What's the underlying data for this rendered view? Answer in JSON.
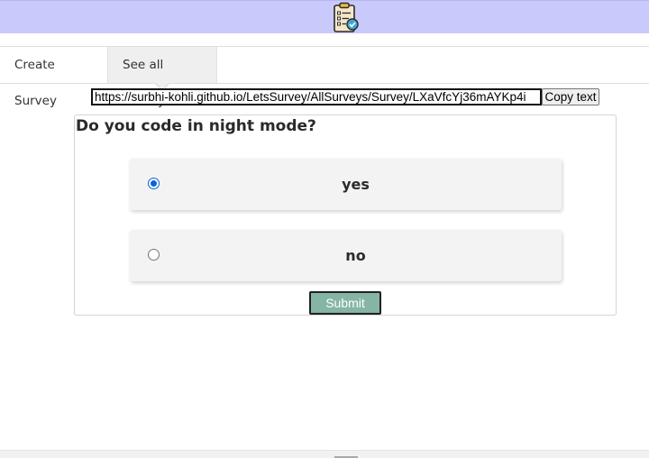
{
  "header": {
    "logo_icon": "clipboard-checklist-icon",
    "brand_color": "#c9c9fb"
  },
  "nav": {
    "tabs": [
      {
        "label": "Create Survey",
        "active": false
      },
      {
        "label": "See all Surveys",
        "active": true
      }
    ]
  },
  "share": {
    "url": "https://surbhi-kohli.github.io/LetsSurvey/AllSurveys/Survey/LXaVfcYj36mAYKp4i",
    "copy_label": "Copy text"
  },
  "survey": {
    "question": "Do you code in night mode?",
    "options": [
      {
        "label": "yes",
        "selected": true
      },
      {
        "label": "no",
        "selected": false
      }
    ],
    "submit_label": "Submit",
    "submit_color": "#85b5a6"
  }
}
